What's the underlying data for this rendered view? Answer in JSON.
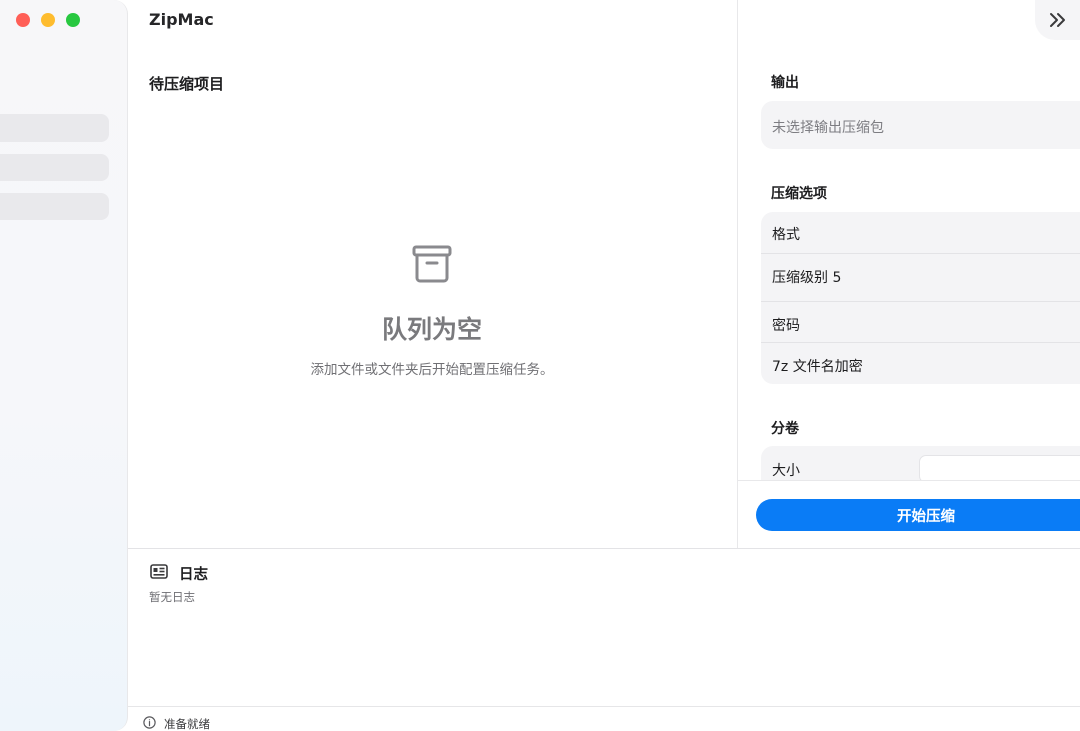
{
  "app": {
    "title": "ZipMac"
  },
  "queue": {
    "title": "待压缩项目",
    "empty_title": "队列为空",
    "empty_desc": "添加文件或文件夹后开始配置压缩任务。",
    "icon": "archive-box-icon"
  },
  "output": {
    "title": "输出",
    "placeholder": "未选择输出压缩包"
  },
  "options": {
    "title": "压缩选项",
    "format_label": "格式",
    "level_label": "压缩级别 5",
    "password_label": "密码",
    "encrypt_names_label": "7z 文件名加密"
  },
  "split": {
    "title": "分卷",
    "size_label": "大小",
    "size_value": ""
  },
  "actions": {
    "start_label": "开始压缩"
  },
  "log": {
    "title": "日志",
    "empty": "暂无日志",
    "icon": "newspaper-icon"
  },
  "status": {
    "text": "准备就绪",
    "icon": "info-icon"
  },
  "colors": {
    "accent": "#0a7cf6",
    "red": "#ff5f57",
    "yellow": "#febc2e",
    "green": "#28c840"
  }
}
